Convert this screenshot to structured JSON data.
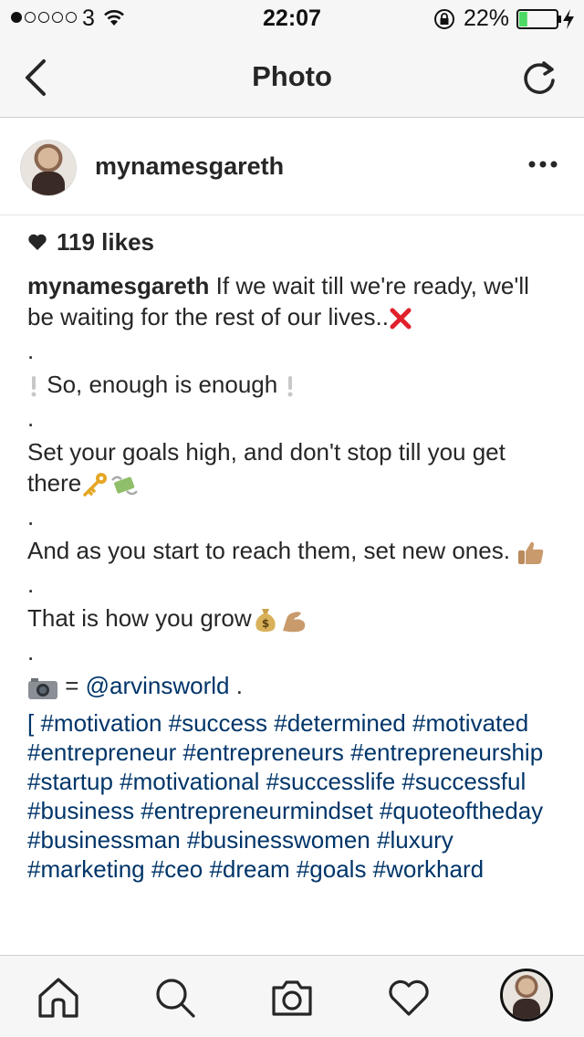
{
  "status_bar": {
    "carrier": "3",
    "time": "22:07",
    "battery_percent": "22%",
    "battery_level": 0.22,
    "signal_bars": 1
  },
  "nav": {
    "title": "Photo",
    "back_icon": "chevron-left-icon",
    "refresh_icon": "refresh-icon"
  },
  "post": {
    "username": "mynamesgareth",
    "more_icon": "more-dots-icon",
    "likes": "119 likes",
    "caption": {
      "author": "mynamesgareth",
      "line1": "If we wait till we're ready, we'll be waiting for the rest of our lives..",
      "dot1": ".",
      "line2": " So, enough is enough ",
      "dot2": ".",
      "line3": "Set your goals high, and don't stop till you get there",
      "dot3": ".",
      "line4": "And as you start to reach them, set new ones. ",
      "dot4": ".",
      "line5": "That is how you grow",
      "dot5": ".",
      "photo_credit_prefix": " = ",
      "photo_credit_handle": "@arvinsworld",
      "photo_credit_suffix": " .",
      "hashtags": "[ #motivation #success #determined #motivated #entrepreneur #entrepreneurs #entrepreneurship #startup #motivational #successlife #successful #business #entrepreneurmindset #quoteoftheday #businessman #businesswomen #luxury #marketing #ceo #dream #goals #workhard"
    }
  },
  "tab_bar": {
    "items": [
      "home-icon",
      "search-icon",
      "camera-icon",
      "heart-icon",
      "profile-avatar"
    ]
  },
  "colors": {
    "text": "#262626",
    "link": "#003569",
    "bar_background": "#f6f6f6",
    "battery_fill": "#4cd964",
    "cross": "#e0202b"
  }
}
